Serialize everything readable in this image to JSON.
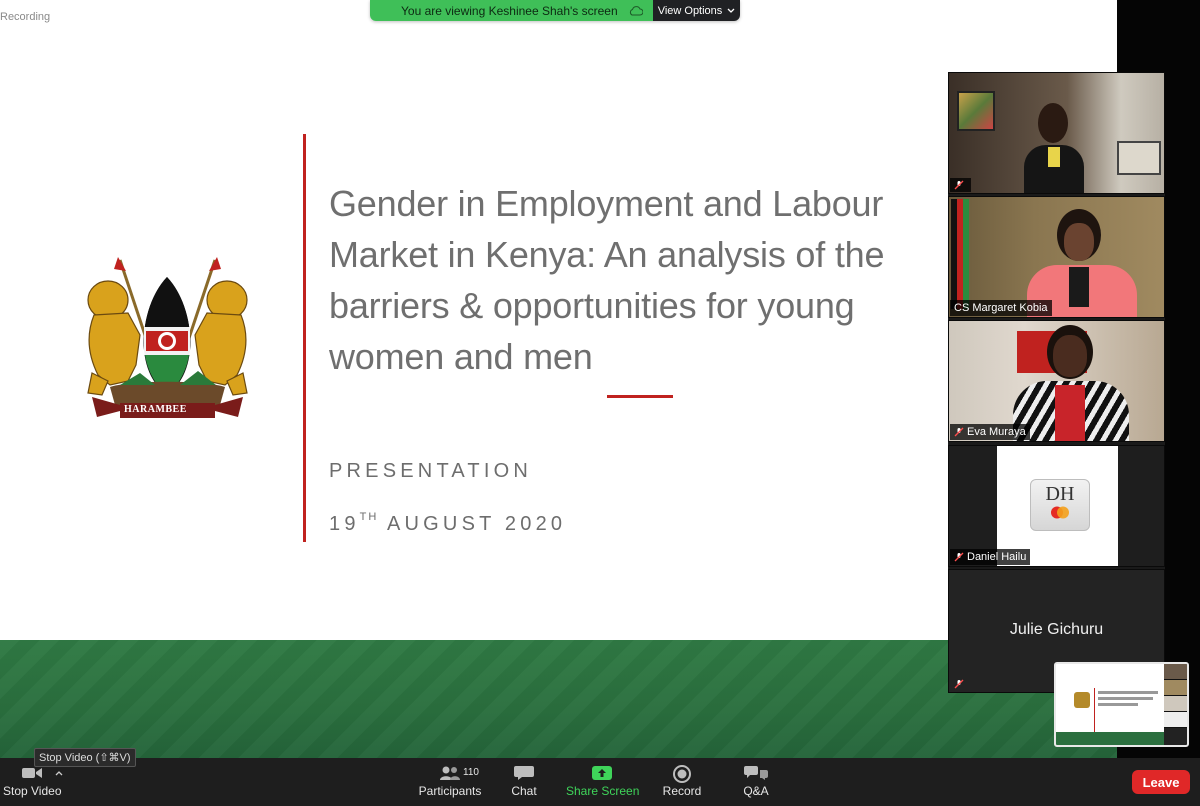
{
  "recording_label": "Recording",
  "banner": {
    "viewing_text": "You are viewing Keshinee Shah's screen",
    "view_options_label": "View Options"
  },
  "slide": {
    "emblem_motto": "HARAMBEE",
    "title": "Gender in Employment and Labour Market in Kenya: An analysis of the barriers & opportunities for young women and men",
    "subtitle": "PRESENTATION",
    "date_day": "19",
    "date_suffix": "TH",
    "date_rest": "AUGUST 2020",
    "colors": {
      "accent_red": "#c0221f",
      "footer_green": "#2b6f3f",
      "title_gray": "#6f6f6f"
    }
  },
  "participants": {
    "tiles": [
      {
        "name": ""
      },
      {
        "name": "CS Margaret Kobia"
      },
      {
        "name": "Eva Muraya"
      },
      {
        "name": "Daniel Hailu",
        "initials": "DH"
      },
      {
        "name": "Julie Gichuru"
      }
    ]
  },
  "toolbar": {
    "stop_video_label": "Stop Video",
    "stop_video_tooltip": "Stop Video (⇧⌘V)",
    "participants_label": "Participants",
    "participants_count": "110",
    "chat_label": "Chat",
    "share_screen_label": "Share Screen",
    "record_label": "Record",
    "qa_label": "Q&A",
    "leave_label": "Leave",
    "colors": {
      "share_green": "#3fd45a",
      "leave_red": "#e02828"
    }
  }
}
